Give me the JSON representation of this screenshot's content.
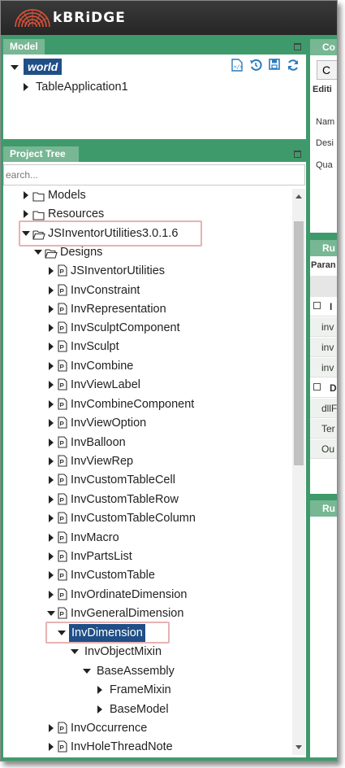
{
  "app": {
    "brand": "kBRiDGE"
  },
  "model_panel": {
    "title": "Model",
    "root_label": "world",
    "child_label": "TableApplication1",
    "toolbar": [
      "code-file-icon",
      "undo-icon",
      "save-icon",
      "refresh-icon"
    ]
  },
  "tree_panel": {
    "title": "Project Tree",
    "search_placeholder": "earch...",
    "items": [
      {
        "label": "Models",
        "icon": "folder"
      },
      {
        "label": "Resources",
        "icon": "folder"
      },
      {
        "label": "JSInventorUtilities3.0.1.6",
        "icon": "folder-open"
      },
      {
        "label": "Designs",
        "icon": "folder-open"
      },
      {
        "label": "JSInventorUtilities",
        "icon": "file"
      },
      {
        "label": "InvConstraint",
        "icon": "file"
      },
      {
        "label": "InvRepresentation",
        "icon": "file"
      },
      {
        "label": "InvSculptComponent",
        "icon": "file"
      },
      {
        "label": "InvSculpt",
        "icon": "file"
      },
      {
        "label": "InvCombine",
        "icon": "file"
      },
      {
        "label": "InvViewLabel",
        "icon": "file"
      },
      {
        "label": "InvCombineComponent",
        "icon": "file"
      },
      {
        "label": "InvViewOption",
        "icon": "file"
      },
      {
        "label": "InvBalloon",
        "icon": "file"
      },
      {
        "label": "InvViewRep",
        "icon": "file"
      },
      {
        "label": "InvCustomTableCell",
        "icon": "file"
      },
      {
        "label": "InvCustomTableRow",
        "icon": "file"
      },
      {
        "label": "InvCustomTableColumn",
        "icon": "file"
      },
      {
        "label": "InvMacro",
        "icon": "file"
      },
      {
        "label": "InvPartsList",
        "icon": "file"
      },
      {
        "label": "InvCustomTable",
        "icon": "file"
      },
      {
        "label": "InvOrdinateDimension",
        "icon": "file"
      },
      {
        "label": "InvGeneralDimension",
        "icon": "file"
      },
      {
        "label": "InvDimension",
        "icon": "none"
      },
      {
        "label": "InvObjectMixin",
        "icon": "none"
      },
      {
        "label": "BaseAssembly",
        "icon": "none"
      },
      {
        "label": "FrameMixin",
        "icon": "none"
      },
      {
        "label": "BaseModel",
        "icon": "none"
      },
      {
        "label": "InvOccurrence",
        "icon": "file"
      },
      {
        "label": "InvHoleThreadNote",
        "icon": "file"
      }
    ]
  },
  "right_panels": {
    "top_header": "Co",
    "top_tab": "C",
    "top_editing": "Editi",
    "fields": [
      "Nam",
      "Desi",
      "Qua"
    ],
    "rules_header": "Ru",
    "param_header": "Paran",
    "rows": [
      "I",
      "inv",
      "inv",
      "inv",
      "D",
      "dllF",
      "Ter",
      "Ou"
    ],
    "bottom_header": "Ru"
  },
  "colors": {
    "accent_green": "#3f9a6b",
    "tab_green": "#77b793",
    "selection_blue": "#1f4f86",
    "highlight_pink": "#e6b3b3"
  }
}
